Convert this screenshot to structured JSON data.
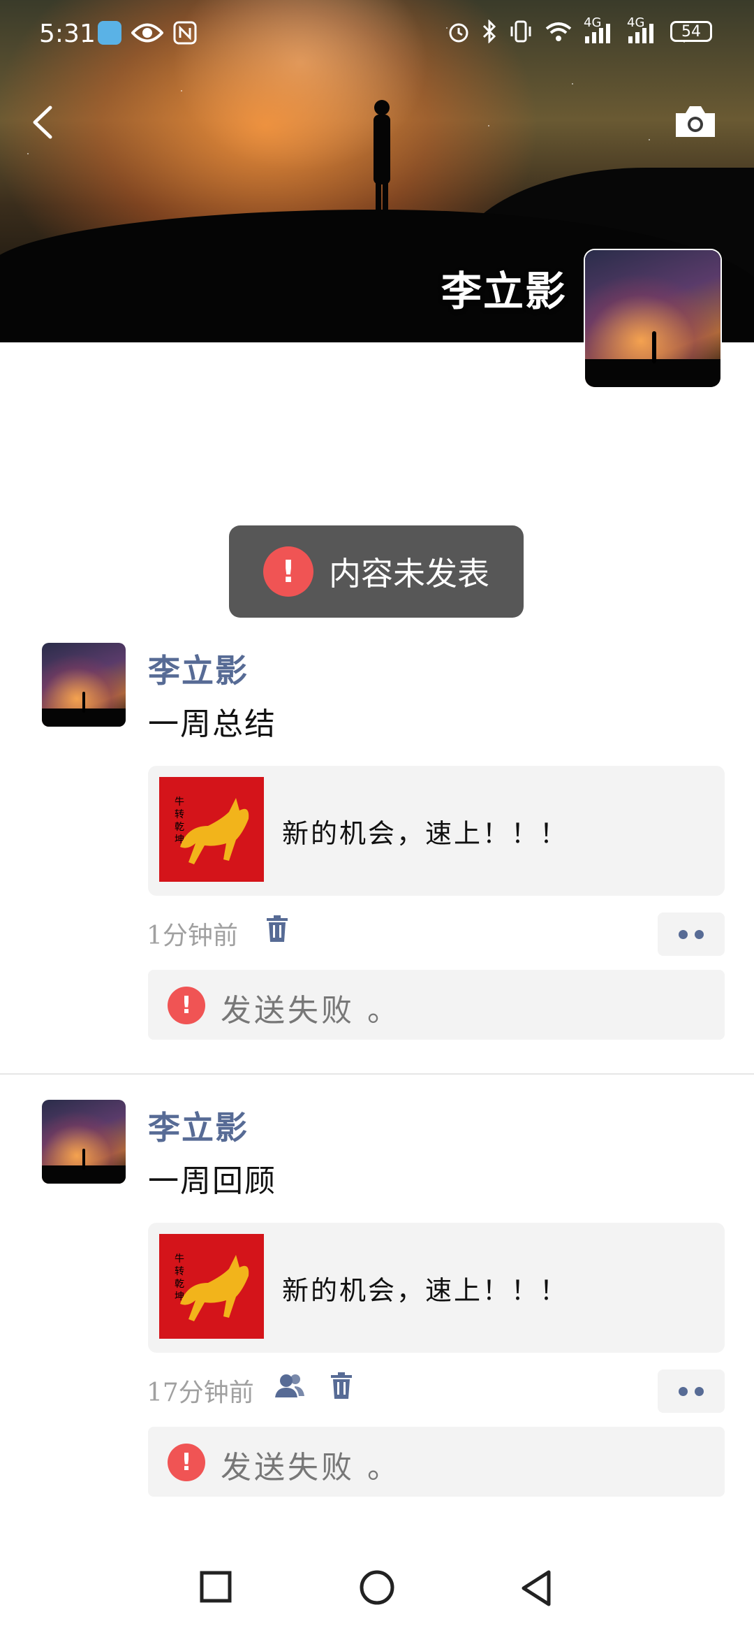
{
  "status_bar": {
    "time": "5:31",
    "battery": "54",
    "net1": "4G",
    "net2": "4G"
  },
  "cover": {
    "name": "李立影"
  },
  "toast": {
    "text": "内容未发表"
  },
  "posts": [
    {
      "author": "李立影",
      "content": "一周总结",
      "link_text": "新的机会，速上！！！",
      "time": "1分钟前",
      "fail_text": "发送失败 。"
    },
    {
      "author": "李立影",
      "content": "一周回顾",
      "link_text": "新的机会，速上！！！",
      "time": "17分钟前",
      "fail_text": "发送失败 。"
    }
  ],
  "colors": {
    "accent": "#576b95",
    "error": "#f05454",
    "toast_bg": "#575757"
  },
  "icons": [
    "back-icon",
    "camera-icon",
    "trash-icon",
    "contacts-icon",
    "more-icon",
    "alert-icon"
  ]
}
